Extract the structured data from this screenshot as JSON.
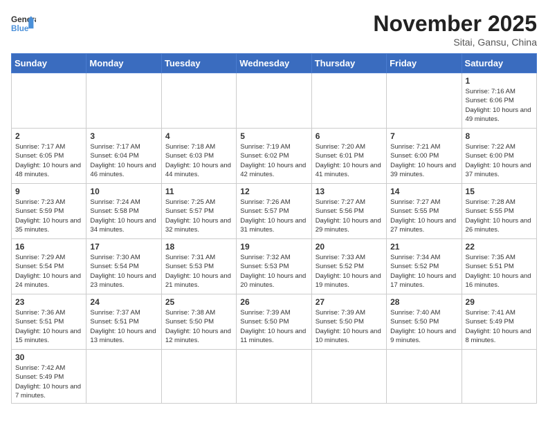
{
  "logo": {
    "text_general": "General",
    "text_blue": "Blue"
  },
  "title": "November 2025",
  "location": "Sitai, Gansu, China",
  "days_of_week": [
    "Sunday",
    "Monday",
    "Tuesday",
    "Wednesday",
    "Thursday",
    "Friday",
    "Saturday"
  ],
  "weeks": [
    [
      {
        "day": "",
        "info": ""
      },
      {
        "day": "",
        "info": ""
      },
      {
        "day": "",
        "info": ""
      },
      {
        "day": "",
        "info": ""
      },
      {
        "day": "",
        "info": ""
      },
      {
        "day": "",
        "info": ""
      },
      {
        "day": "1",
        "info": "Sunrise: 7:16 AM\nSunset: 6:06 PM\nDaylight: 10 hours and 49 minutes."
      }
    ],
    [
      {
        "day": "2",
        "info": "Sunrise: 7:17 AM\nSunset: 6:05 PM\nDaylight: 10 hours and 48 minutes."
      },
      {
        "day": "3",
        "info": "Sunrise: 7:17 AM\nSunset: 6:04 PM\nDaylight: 10 hours and 46 minutes."
      },
      {
        "day": "4",
        "info": "Sunrise: 7:18 AM\nSunset: 6:03 PM\nDaylight: 10 hours and 44 minutes."
      },
      {
        "day": "5",
        "info": "Sunrise: 7:19 AM\nSunset: 6:02 PM\nDaylight: 10 hours and 42 minutes."
      },
      {
        "day": "6",
        "info": "Sunrise: 7:20 AM\nSunset: 6:01 PM\nDaylight: 10 hours and 41 minutes."
      },
      {
        "day": "7",
        "info": "Sunrise: 7:21 AM\nSunset: 6:00 PM\nDaylight: 10 hours and 39 minutes."
      },
      {
        "day": "8",
        "info": "Sunrise: 7:22 AM\nSunset: 6:00 PM\nDaylight: 10 hours and 37 minutes."
      }
    ],
    [
      {
        "day": "9",
        "info": "Sunrise: 7:23 AM\nSunset: 5:59 PM\nDaylight: 10 hours and 35 minutes."
      },
      {
        "day": "10",
        "info": "Sunrise: 7:24 AM\nSunset: 5:58 PM\nDaylight: 10 hours and 34 minutes."
      },
      {
        "day": "11",
        "info": "Sunrise: 7:25 AM\nSunset: 5:57 PM\nDaylight: 10 hours and 32 minutes."
      },
      {
        "day": "12",
        "info": "Sunrise: 7:26 AM\nSunset: 5:57 PM\nDaylight: 10 hours and 31 minutes."
      },
      {
        "day": "13",
        "info": "Sunrise: 7:27 AM\nSunset: 5:56 PM\nDaylight: 10 hours and 29 minutes."
      },
      {
        "day": "14",
        "info": "Sunrise: 7:27 AM\nSunset: 5:55 PM\nDaylight: 10 hours and 27 minutes."
      },
      {
        "day": "15",
        "info": "Sunrise: 7:28 AM\nSunset: 5:55 PM\nDaylight: 10 hours and 26 minutes."
      }
    ],
    [
      {
        "day": "16",
        "info": "Sunrise: 7:29 AM\nSunset: 5:54 PM\nDaylight: 10 hours and 24 minutes."
      },
      {
        "day": "17",
        "info": "Sunrise: 7:30 AM\nSunset: 5:54 PM\nDaylight: 10 hours and 23 minutes."
      },
      {
        "day": "18",
        "info": "Sunrise: 7:31 AM\nSunset: 5:53 PM\nDaylight: 10 hours and 21 minutes."
      },
      {
        "day": "19",
        "info": "Sunrise: 7:32 AM\nSunset: 5:53 PM\nDaylight: 10 hours and 20 minutes."
      },
      {
        "day": "20",
        "info": "Sunrise: 7:33 AM\nSunset: 5:52 PM\nDaylight: 10 hours and 19 minutes."
      },
      {
        "day": "21",
        "info": "Sunrise: 7:34 AM\nSunset: 5:52 PM\nDaylight: 10 hours and 17 minutes."
      },
      {
        "day": "22",
        "info": "Sunrise: 7:35 AM\nSunset: 5:51 PM\nDaylight: 10 hours and 16 minutes."
      }
    ],
    [
      {
        "day": "23",
        "info": "Sunrise: 7:36 AM\nSunset: 5:51 PM\nDaylight: 10 hours and 15 minutes."
      },
      {
        "day": "24",
        "info": "Sunrise: 7:37 AM\nSunset: 5:51 PM\nDaylight: 10 hours and 13 minutes."
      },
      {
        "day": "25",
        "info": "Sunrise: 7:38 AM\nSunset: 5:50 PM\nDaylight: 10 hours and 12 minutes."
      },
      {
        "day": "26",
        "info": "Sunrise: 7:39 AM\nSunset: 5:50 PM\nDaylight: 10 hours and 11 minutes."
      },
      {
        "day": "27",
        "info": "Sunrise: 7:39 AM\nSunset: 5:50 PM\nDaylight: 10 hours and 10 minutes."
      },
      {
        "day": "28",
        "info": "Sunrise: 7:40 AM\nSunset: 5:50 PM\nDaylight: 10 hours and 9 minutes."
      },
      {
        "day": "29",
        "info": "Sunrise: 7:41 AM\nSunset: 5:49 PM\nDaylight: 10 hours and 8 minutes."
      }
    ],
    [
      {
        "day": "30",
        "info": "Sunrise: 7:42 AM\nSunset: 5:49 PM\nDaylight: 10 hours and 7 minutes."
      },
      {
        "day": "",
        "info": ""
      },
      {
        "day": "",
        "info": ""
      },
      {
        "day": "",
        "info": ""
      },
      {
        "day": "",
        "info": ""
      },
      {
        "day": "",
        "info": ""
      },
      {
        "day": "",
        "info": ""
      }
    ]
  ]
}
